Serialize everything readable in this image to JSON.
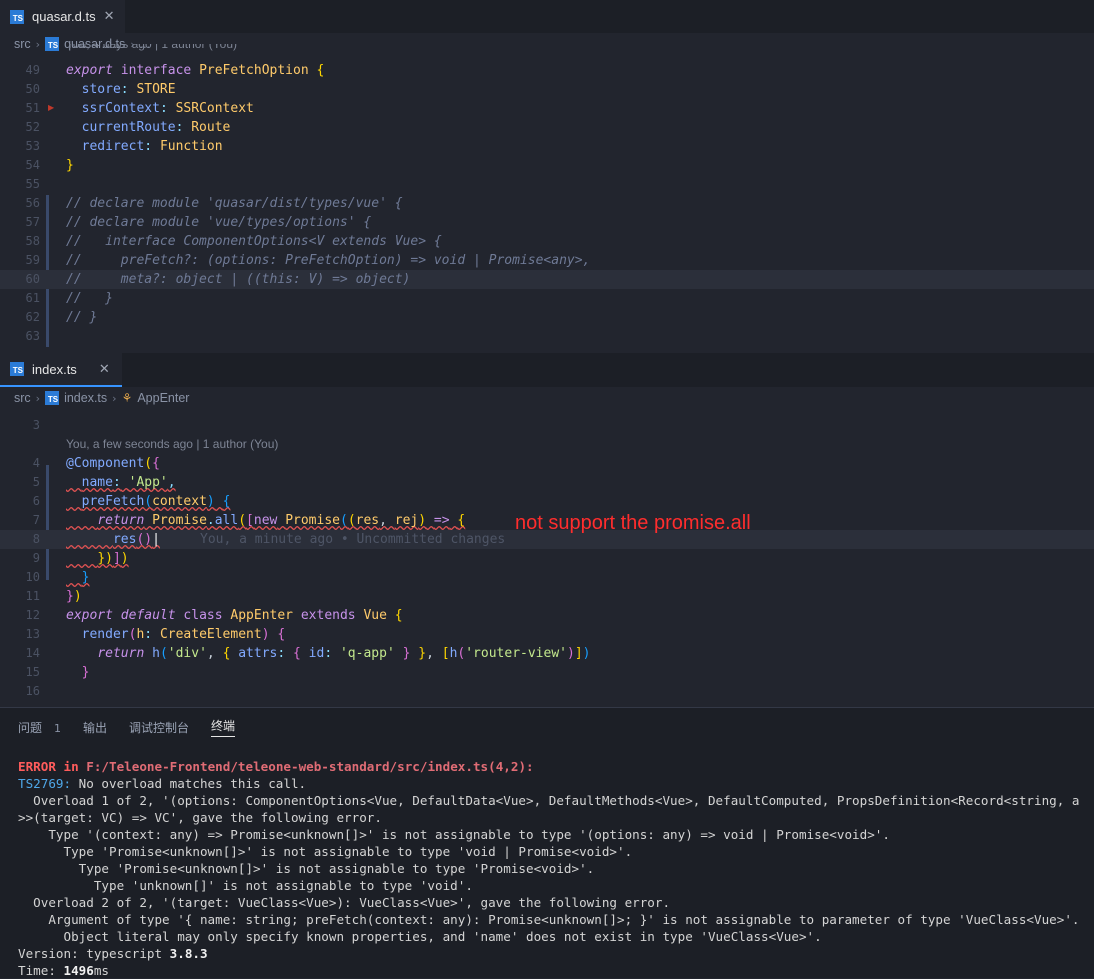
{
  "top_editor": {
    "tab": {
      "icon": "TS",
      "label": "quasar.d.ts"
    },
    "breadcrumb": {
      "folder": "src",
      "file": "quasar.d.ts",
      "more": "..."
    },
    "codelens": "You, 4 days ago | 1 author (You)",
    "line_numbers": [
      "49",
      "50",
      "51",
      "52",
      "53",
      "54",
      "55",
      "56",
      "57",
      "58",
      "59",
      "60",
      "61",
      "62",
      "63"
    ]
  },
  "bottom_editor": {
    "tab": {
      "icon": "TS",
      "label": "index.ts"
    },
    "breadcrumb": {
      "folder": "src",
      "file": "index.ts",
      "symbol": "AppEnter"
    },
    "codelens": "You, a few seconds ago | 1 author (You)",
    "ghost_blame": "You, a minute ago • Uncommitted changes",
    "line_numbers": [
      "3",
      "4",
      "5",
      "6",
      "7",
      "8",
      "9",
      "10",
      "11",
      "12",
      "13",
      "14",
      "15",
      "16"
    ]
  },
  "annotation": "not support the promise.all",
  "panel": {
    "tabs": [
      "问题",
      "输出",
      "调试控制台",
      "终端"
    ],
    "problems_count": "1",
    "terminal": {
      "error_label": "ERROR",
      "error_in": " in ",
      "error_path": "F:/Teleone-Frontend/teleone-web-standard/src/index.ts(4,2):",
      "code": "TS2769:",
      "code_msg": " No overload matches this call.",
      "l3": "  Overload 1 of 2, '(options: ComponentOptions<Vue, DefaultData<Vue>, DefaultMethods<Vue>, DefaultComputed, PropsDefinition<Record<string, a",
      "l4": ">>(target: VC) => VC', gave the following error.",
      "l5": "    Type '(context: any) => Promise<unknown[]>' is not assignable to type '(options: any) => void | Promise<void>'.",
      "l6": "      Type 'Promise<unknown[]>' is not assignable to type 'void | Promise<void>'.",
      "l7": "        Type 'Promise<unknown[]>' is not assignable to type 'Promise<void>'.",
      "l8": "          Type 'unknown[]' is not assignable to type 'void'.",
      "l9": "  Overload 2 of 2, '(target: VueClass<Vue>): VueClass<Vue>', gave the following error.",
      "l10": "    Argument of type '{ name: string; preFetch(context: any): Promise<unknown[]>; }' is not assignable to parameter of type 'VueClass<Vue>'.",
      "l11": "      Object literal may only specify known properties, and 'name' does not exist in type 'VueClass<Vue>'.",
      "version_label": "Version: typescript ",
      "version": "3.8.3",
      "time_label": "Time: ",
      "time": "1496",
      "time_unit": "ms"
    }
  }
}
